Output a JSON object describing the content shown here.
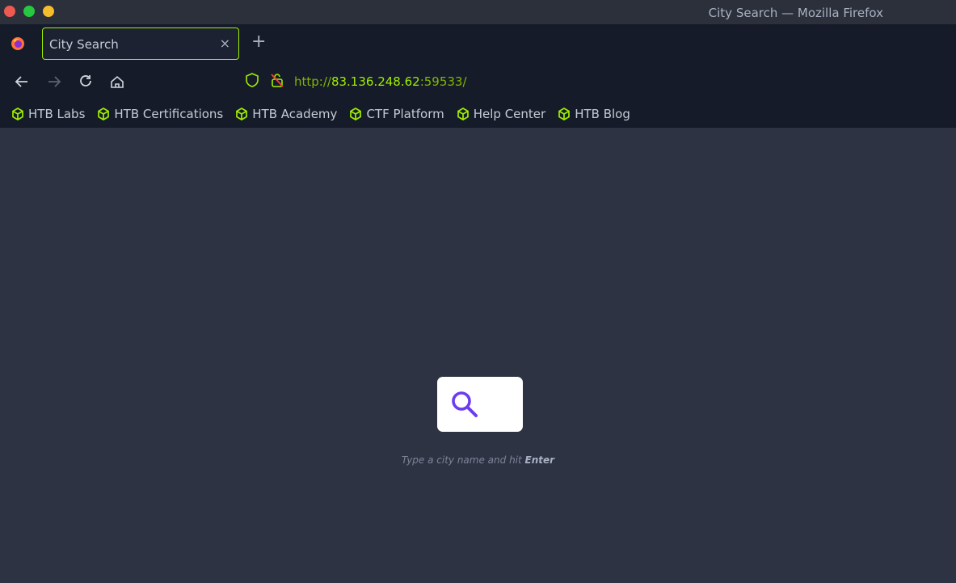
{
  "window": {
    "title": "City Search — Mozilla Firefox"
  },
  "tab": {
    "title": "City Search",
    "close_glyph": "×",
    "new_tab_glyph": "+"
  },
  "navbar": {
    "url_scheme": "http://",
    "url_host": "83.136.248.62",
    "url_rest": ":59533/",
    "icons": [
      "back-icon",
      "forward-icon",
      "reload-icon",
      "home-icon",
      "shield-icon",
      "insecure-lock-icon"
    ]
  },
  "bookmarks": {
    "items": [
      {
        "label": "HTB Labs"
      },
      {
        "label": "HTB Certifications"
      },
      {
        "label": "HTB Academy"
      },
      {
        "label": "CTF Platform"
      },
      {
        "label": "Help Center"
      },
      {
        "label": "HTB Blog"
      }
    ]
  },
  "search": {
    "value": "",
    "hint_prefix": "Type a city name and hit ",
    "hint_key": "Enter"
  },
  "colors": {
    "accent": "#9fef00",
    "search_icon": "#6c3cf0",
    "page_bg": "#2e3344",
    "chrome_bg": "#151b28"
  }
}
